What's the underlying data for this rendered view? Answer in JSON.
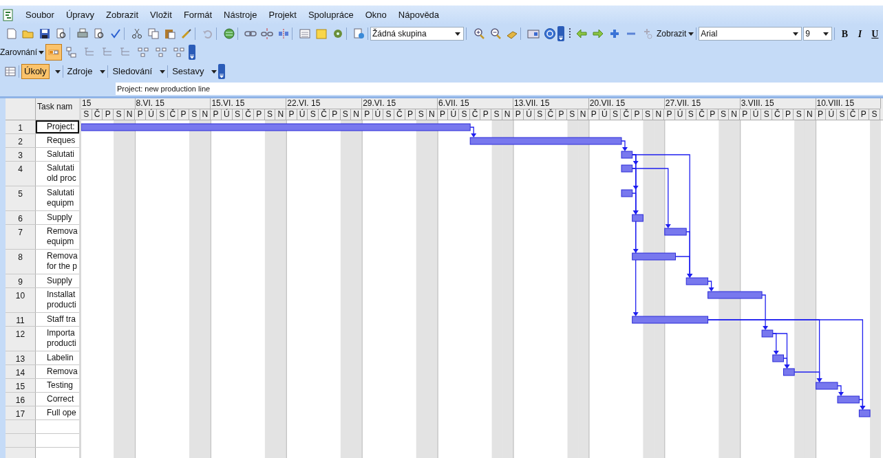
{
  "menu": [
    {
      "label": "Soubor"
    },
    {
      "label": "Úpravy"
    },
    {
      "label": "Zobrazit"
    },
    {
      "label": "Vložit"
    },
    {
      "label": "Formát"
    },
    {
      "label": "Nástroje"
    },
    {
      "label": "Projekt"
    },
    {
      "label": "Spolupráce"
    },
    {
      "label": "Okno"
    },
    {
      "label": "Nápověda"
    }
  ],
  "toolbar": {
    "group_combo": "Žádná skupina",
    "view_button": "Zobrazit",
    "font_combo": "Arial",
    "size_combo": "9",
    "format_buttons": [
      {
        "label": "B",
        "kind": "bold"
      },
      {
        "label": "I",
        "kind": "italic"
      },
      {
        "label": "U",
        "kind": "underline"
      }
    ]
  },
  "outline_bar": {
    "align_button": "Zarovnání",
    "tools": [
      {
        "selected": true
      },
      {
        "selected": false
      },
      {
        "selected": false
      },
      {
        "selected": false
      },
      {
        "selected": false
      },
      {
        "selected": false
      },
      {
        "selected": false
      },
      {
        "selected": false
      }
    ]
  },
  "view_bar": {
    "items": [
      {
        "label": "Úkoly",
        "selected": true
      },
      {
        "label": "Zdroje",
        "selected": false
      },
      {
        "label": "Sledování",
        "selected": false
      },
      {
        "label": "Sestavy",
        "selected": false
      }
    ]
  },
  "entry_bar": {
    "value": "Project: new production line"
  },
  "table": {
    "column": "Task nam",
    "rows": [
      {
        "id": "1",
        "name": "Project:",
        "selected": true
      },
      {
        "id": "2",
        "name": "Reques",
        "selected": false
      },
      {
        "id": "3",
        "name": "Salutati",
        "selected": false
      },
      {
        "id": "4",
        "name": "Salutati\nold proc",
        "selected": false
      },
      {
        "id": "5",
        "name": "Salutati\nequipm",
        "selected": false
      },
      {
        "id": "6",
        "name": "Supply",
        "selected": false
      },
      {
        "id": "7",
        "name": "Remova\nequipm",
        "selected": false
      },
      {
        "id": "8",
        "name": "Remova\nfor the p",
        "selected": false
      },
      {
        "id": "9",
        "name": "Supply",
        "selected": false
      },
      {
        "id": "10",
        "name": "Installat\nproducti",
        "selected": false
      },
      {
        "id": "11",
        "name": "Staff tra",
        "selected": false
      },
      {
        "id": "12",
        "name": "Importa\nproducti",
        "selected": false
      },
      {
        "id": "13",
        "name": "Labelin",
        "selected": false
      },
      {
        "id": "14",
        "name": "Remova",
        "selected": false
      },
      {
        "id": "15",
        "name": "Testing",
        "selected": false
      },
      {
        "id": "16",
        "name": "Correct",
        "selected": false
      },
      {
        "id": "17",
        "name": "Full ope",
        "selected": false
      }
    ]
  },
  "timeline": {
    "weeks": [
      {
        "label": "15",
        "days": [
          "S",
          "Č",
          "P",
          "S",
          "N"
        ]
      },
      {
        "label": "8.VI. 15",
        "days": [
          "P",
          "Ú",
          "S",
          "Č",
          "P",
          "S",
          "N"
        ]
      },
      {
        "label": "15.VI. 15",
        "days": [
          "P",
          "Ú",
          "S",
          "Č",
          "P",
          "S",
          "N"
        ]
      },
      {
        "label": "22.VI. 15",
        "days": [
          "P",
          "Ú",
          "S",
          "Č",
          "P",
          "S",
          "N"
        ]
      },
      {
        "label": "29.VI. 15",
        "days": [
          "P",
          "Ú",
          "S",
          "Č",
          "P",
          "S",
          "N"
        ]
      },
      {
        "label": "6.VII. 15",
        "days": [
          "P",
          "Ú",
          "S",
          "Č",
          "P",
          "S",
          "N"
        ]
      },
      {
        "label": "13.VII. 15",
        "days": [
          "P",
          "Ú",
          "S",
          "Č",
          "P",
          "S",
          "N"
        ]
      },
      {
        "label": "20.VII. 15",
        "days": [
          "P",
          "Ú",
          "S",
          "Č",
          "P",
          "S",
          "N"
        ]
      },
      {
        "label": "27.VII. 15",
        "days": [
          "P",
          "Ú",
          "S",
          "Č",
          "P",
          "S",
          "N"
        ]
      },
      {
        "label": "3.VIII. 15",
        "days": [
          "P",
          "Ú",
          "S",
          "Č",
          "P",
          "S",
          "N"
        ]
      },
      {
        "label": "10.VIII. 15",
        "days": [
          "P",
          "Ú",
          "S",
          "Č",
          "P",
          "S"
        ]
      }
    ]
  }
}
